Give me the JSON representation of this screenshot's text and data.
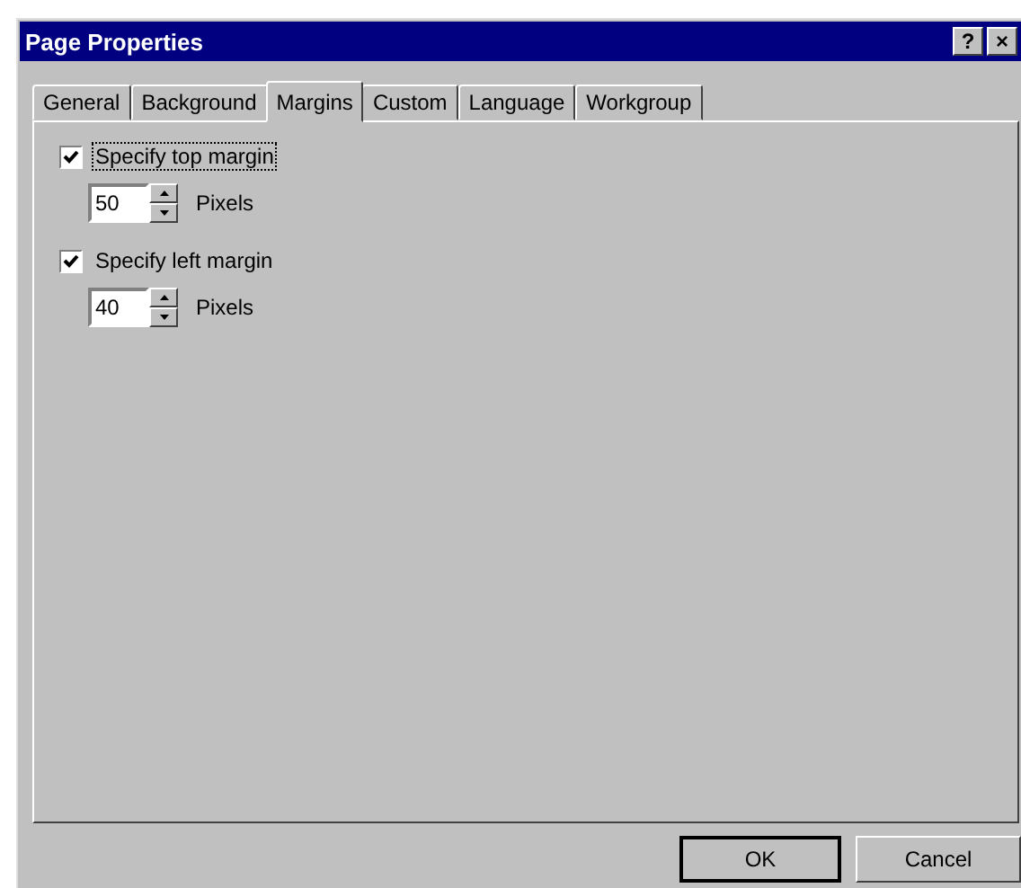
{
  "window": {
    "title": "Page Properties",
    "title_buttons": [
      "?",
      "×"
    ]
  },
  "tabs": [
    {
      "label": "General",
      "selected": false
    },
    {
      "label": "Background",
      "selected": false
    },
    {
      "label": "Margins",
      "selected": true
    },
    {
      "label": "Custom",
      "selected": false
    },
    {
      "label": "Language",
      "selected": false
    },
    {
      "label": "Workgroup",
      "selected": false
    }
  ],
  "options": [
    {
      "label": "Specify top margin",
      "checked": true,
      "focused": true,
      "value": "50",
      "unit": "Pixels"
    },
    {
      "label": "Specify left margin",
      "checked": true,
      "focused": false,
      "value": "40",
      "unit": "Pixels"
    }
  ],
  "buttons": [
    "OK",
    "Cancel"
  ]
}
